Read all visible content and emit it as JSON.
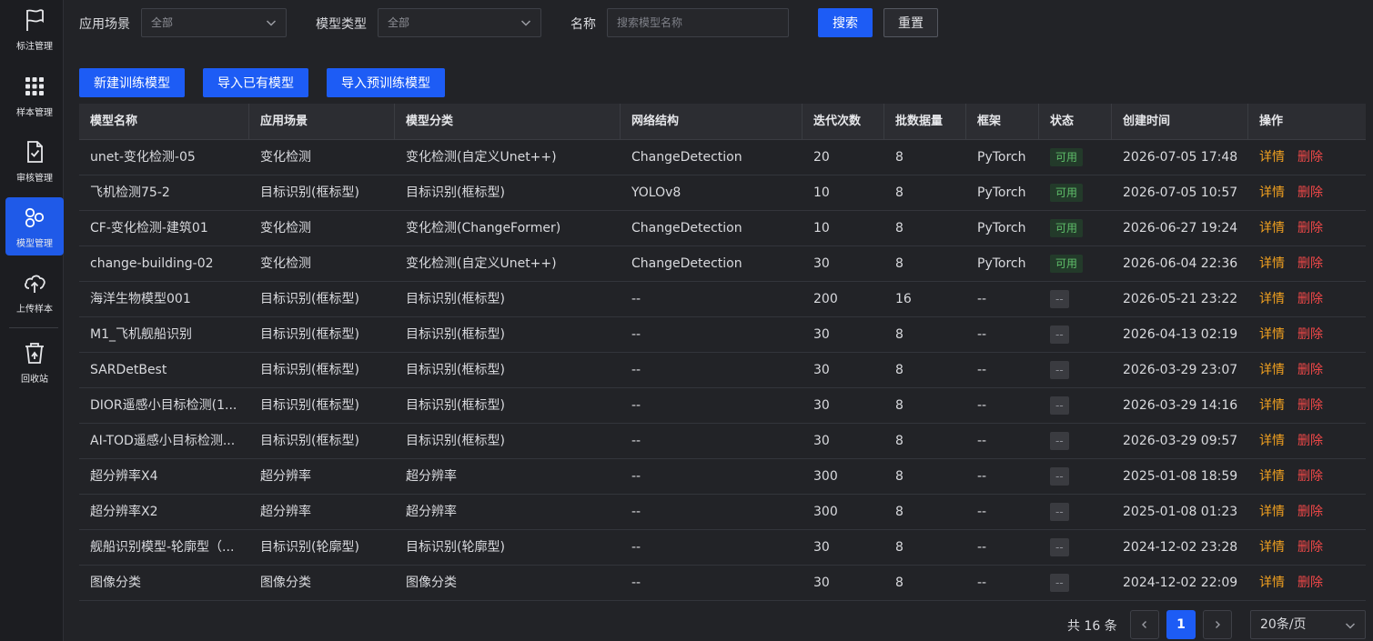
{
  "sidebar": {
    "items": [
      {
        "label": "标注管理",
        "icon": "flag-icon"
      },
      {
        "label": "样本管理",
        "icon": "grid-icon"
      },
      {
        "label": "审核管理",
        "icon": "doc-check-icon"
      },
      {
        "label": "模型管理",
        "icon": "model-icon",
        "active": true
      },
      {
        "label": "上传样本",
        "icon": "cloud-upload-icon"
      },
      {
        "label": "回收站",
        "icon": "recycle-bin-icon"
      }
    ]
  },
  "filters": {
    "scene_label": "应用场景",
    "scene_value": "全部",
    "type_label": "模型类型",
    "type_value": "全部",
    "name_label": "名称",
    "name_placeholder": "搜索模型名称",
    "search_button": "搜索",
    "reset_button": "重置"
  },
  "actions": {
    "new_button": "新建训练模型",
    "import_button": "导入已有模型",
    "import_pretrained_button": "导入预训练模型"
  },
  "table": {
    "headers": [
      "模型名称",
      "应用场景",
      "模型分类",
      "网络结构",
      "迭代次数",
      "批数据量",
      "框架",
      "状态",
      "创建时间",
      "操作"
    ],
    "detail_label": "详情",
    "delete_label": "删除",
    "rows": [
      [
        "unet-变化检测-05",
        "变化检测",
        "变化检测(自定义Unet++)",
        "ChangeDetection",
        "20",
        "8",
        "PyTorch",
        "可用",
        "2026-07-05 17:48"
      ],
      [
        "飞机检测75-2",
        "目标识别(框标型)",
        "目标识别(框标型)",
        "YOLOv8",
        "10",
        "8",
        "PyTorch",
        "可用",
        "2026-07-05 10:57"
      ],
      [
        "CF-变化检测-建筑01",
        "变化检测",
        "变化检测(ChangeFormer)",
        "ChangeDetection",
        "10",
        "8",
        "PyTorch",
        "可用",
        "2026-06-27 19:24"
      ],
      [
        "change-building-02",
        "变化检测",
        "变化检测(自定义Unet++)",
        "ChangeDetection",
        "30",
        "8",
        "PyTorch",
        "可用",
        "2026-06-04 22:36"
      ],
      [
        "海洋生物模型001",
        "目标识别(框标型)",
        "目标识别(框标型)",
        "--",
        "200",
        "16",
        "--",
        "--",
        "2026-05-21 23:22"
      ],
      [
        "M1_飞机舰船识别",
        "目标识别(框标型)",
        "目标识别(框标型)",
        "--",
        "30",
        "8",
        "--",
        "--",
        "2026-04-13 02:19"
      ],
      [
        "SARDetBest",
        "目标识别(框标型)",
        "目标识别(框标型)",
        "--",
        "30",
        "8",
        "--",
        "--",
        "2026-03-29 23:07"
      ],
      [
        "DIOR遥感小目标检测(1...",
        "目标识别(框标型)",
        "目标识别(框标型)",
        "--",
        "30",
        "8",
        "--",
        "--",
        "2026-03-29 14:16"
      ],
      [
        "AI-TOD遥感小目标检测...",
        "目标识别(框标型)",
        "目标识别(框标型)",
        "--",
        "30",
        "8",
        "--",
        "--",
        "2026-03-29 09:57"
      ],
      [
        "超分辨率X4",
        "超分辨率",
        "超分辨率",
        "--",
        "300",
        "8",
        "--",
        "--",
        "2025-01-08 18:59"
      ],
      [
        "超分辨率X2",
        "超分辨率",
        "超分辨率",
        "--",
        "300",
        "8",
        "--",
        "--",
        "2025-01-08 01:23"
      ],
      [
        "舰船识别模型-轮廓型（...",
        "目标识别(轮廓型)",
        "目标识别(轮廓型)",
        "--",
        "30",
        "8",
        "--",
        "--",
        "2024-12-02 23:28"
      ],
      [
        "图像分类",
        "图像分类",
        "图像分类",
        "--",
        "30",
        "8",
        "--",
        "--",
        "2024-12-02 22:09"
      ]
    ]
  },
  "pagination": {
    "total_text": "共 16 条",
    "current_page": "1",
    "page_size": "20条/页"
  },
  "colors": {
    "accent": "#1d5cf5",
    "ok_status": "#5fbf6a",
    "detail": "#f0a020",
    "delete": "#f04848"
  }
}
